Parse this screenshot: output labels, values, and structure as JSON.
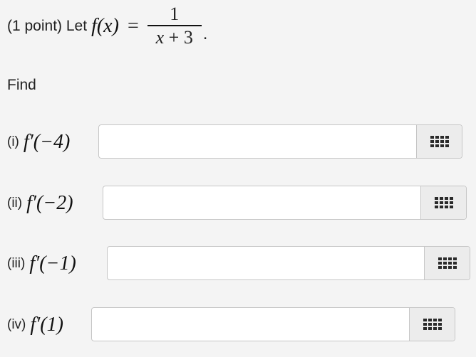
{
  "problem": {
    "prefix": "(1 point) Let",
    "function_lhs": "f(x)",
    "equals": "=",
    "numerator": "1",
    "denominator_var": "x",
    "denominator_rest": " + 3",
    "period": "."
  },
  "find_label": "Find",
  "parts": [
    {
      "label": "(i)",
      "expr": "f′(−4)",
      "value": ""
    },
    {
      "label": "(ii)",
      "expr": "f′(−2)",
      "value": ""
    },
    {
      "label": "(iii)",
      "expr": "f′(−1)",
      "value": ""
    },
    {
      "label": "(iv)",
      "expr": "f′(1)",
      "value": ""
    }
  ],
  "icons": {
    "keypad": "math-keypad-icon"
  }
}
